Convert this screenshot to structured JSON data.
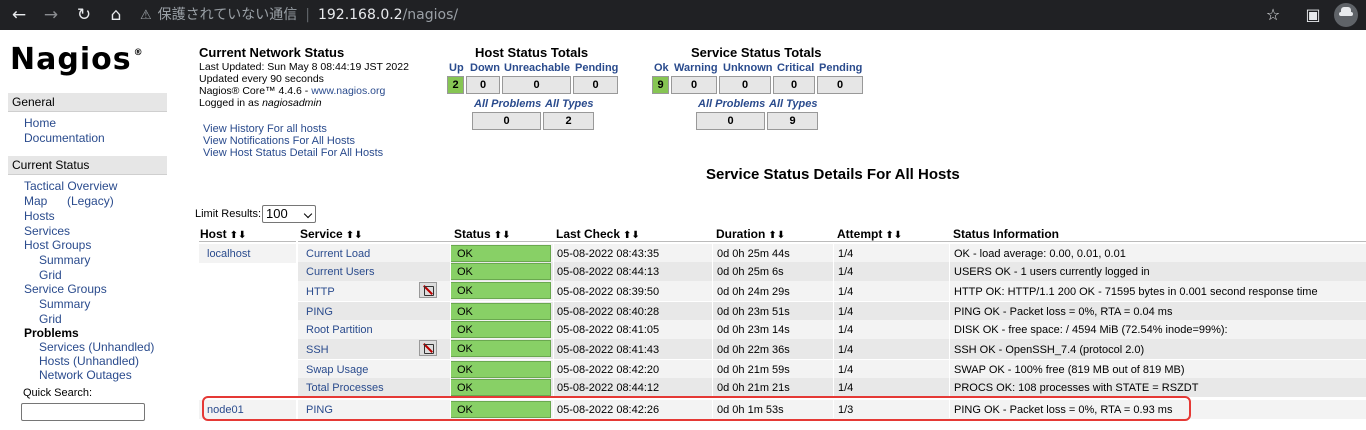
{
  "browser": {
    "security_label": "保護されていない通信",
    "url_host": "192.168.0.2",
    "url_path": "/nagios/"
  },
  "logo": {
    "text": "Nagios",
    "mark": "®"
  },
  "sidebar": {
    "general_header": "General",
    "general_links": [
      "Home",
      "Documentation"
    ],
    "current_status_header": "Current Status",
    "tactical": "Tactical Overview",
    "map": "Map",
    "legacy": "(Legacy)",
    "hosts": "Hosts",
    "services": "Services",
    "host_groups": "Host Groups",
    "hg_summary": "Summary",
    "hg_grid": "Grid",
    "service_groups": "Service Groups",
    "sg_summary": "Summary",
    "sg_grid": "Grid",
    "problems": "Problems",
    "services_unhandled": "Services (Unhandled)",
    "hosts_unhandled": "Hosts (Unhandled)",
    "network_outages": "Network Outages",
    "quick_search_label": "Quick Search:"
  },
  "status_info": {
    "title": "Current Network Status",
    "last_updated": "Last Updated: Sun May 8 08:44:19 JST 2022",
    "update_freq": "Updated every 90 seconds",
    "core_prefix": "Nagios® Core™ 4.4.6 - ",
    "core_link": "www.nagios.org",
    "logged_prefix": "Logged in as ",
    "logged_user": "nagiosadmin",
    "links": [
      "View History For all hosts",
      "View Notifications For All Hosts",
      "View Host Status Detail For All Hosts"
    ]
  },
  "host_totals": {
    "title": "Host Status Totals",
    "labels": [
      "Up",
      "Down",
      "Unreachable",
      "Pending"
    ],
    "values": [
      "2",
      "0",
      "0",
      "0"
    ],
    "all_labels": [
      "All Problems",
      "All Types"
    ],
    "all_values": [
      "0",
      "2"
    ]
  },
  "service_totals": {
    "title": "Service Status Totals",
    "labels": [
      "Ok",
      "Warning",
      "Unknown",
      "Critical",
      "Pending"
    ],
    "values": [
      "9",
      "0",
      "0",
      "0",
      "0"
    ],
    "all_labels": [
      "All Problems",
      "All Types"
    ],
    "all_values": [
      "0",
      "9"
    ]
  },
  "page_title": "Service Status Details For All Hosts",
  "limit": {
    "label": "Limit Results:",
    "value": "100"
  },
  "table": {
    "columns": [
      "Host",
      "Service",
      "Status",
      "Last Check",
      "Duration",
      "Attempt",
      "Status Information"
    ],
    "sort_arrows": "⬆⬇",
    "rows": [
      {
        "host": "localhost",
        "service": "Current Load",
        "status": "OK",
        "last_check": "05-08-2022 08:43:35",
        "duration": "0d 0h 25m 44s",
        "attempt": "1/4",
        "info": "OK - load average: 0.00, 0.01, 0.01"
      },
      {
        "host": "",
        "service": "Current Users",
        "status": "OK",
        "last_check": "05-08-2022 08:44:13",
        "duration": "0d 0h 25m 6s",
        "attempt": "1/4",
        "info": "USERS OK - 1 users currently logged in"
      },
      {
        "host": "",
        "service": "HTTP",
        "status": "OK",
        "last_check": "05-08-2022 08:39:50",
        "duration": "0d 0h 24m 29s",
        "attempt": "1/4",
        "info": "HTTP OK: HTTP/1.1 200 OK - 71595 bytes in 0.001 second response time"
      },
      {
        "host": "",
        "service": "PING",
        "status": "OK",
        "last_check": "05-08-2022 08:40:28",
        "duration": "0d 0h 23m 51s",
        "attempt": "1/4",
        "info": "PING OK - Packet loss = 0%, RTA = 0.04 ms"
      },
      {
        "host": "",
        "service": "Root Partition",
        "status": "OK",
        "last_check": "05-08-2022 08:41:05",
        "duration": "0d 0h 23m 14s",
        "attempt": "1/4",
        "info": "DISK OK - free space: / 4594 MiB (72.54% inode=99%):"
      },
      {
        "host": "",
        "service": "SSH",
        "status": "OK",
        "last_check": "05-08-2022 08:41:43",
        "duration": "0d 0h 22m 36s",
        "attempt": "1/4",
        "info": "SSH OK - OpenSSH_7.4 (protocol 2.0)"
      },
      {
        "host": "",
        "service": "Swap Usage",
        "status": "OK",
        "last_check": "05-08-2022 08:42:20",
        "duration": "0d 0h 21m 59s",
        "attempt": "1/4",
        "info": "SWAP OK - 100% free (819 MB out of 819 MB)"
      },
      {
        "host": "",
        "service": "Total Processes",
        "status": "OK",
        "last_check": "05-08-2022 08:44:12",
        "duration": "0d 0h 21m 21s",
        "attempt": "1/4",
        "info": "PROCS OK: 108 processes with STATE = RSZDT"
      },
      {
        "host": "node01",
        "service": "PING",
        "status": "OK",
        "last_check": "05-08-2022 08:42:26",
        "duration": "0d 0h 1m 53s",
        "attempt": "1/3",
        "info": "PING OK - Packet loss = 0%, RTA = 0.93 ms"
      }
    ]
  },
  "colors": {
    "ok_green": "#88d066",
    "link": "#2a4b8d",
    "highlight": "#e53935"
  }
}
